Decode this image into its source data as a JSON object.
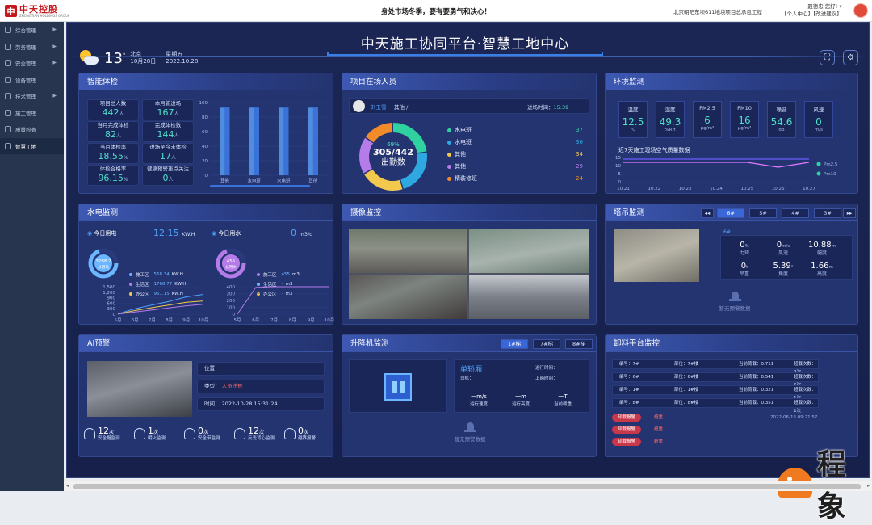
{
  "topbar": {
    "logo_cn": "中天控股",
    "logo_en": "ZHONGTIAN HOLDINGS GROUP",
    "slogan": "身处市场冬季，要有要勇气和决心！",
    "project": "北京朝阳东坝611地块项目总承包工程",
    "user_name": "聂德忠 您好!",
    "user_links": "【个人中心】【改进建议】"
  },
  "sidebar": {
    "items": [
      {
        "label": "综合管理",
        "arrow": true
      },
      {
        "label": "劳务管理",
        "arrow": true
      },
      {
        "label": "安全管理",
        "arrow": true
      },
      {
        "label": "设备管理",
        "arrow": false
      },
      {
        "label": "技术管理",
        "arrow": true
      },
      {
        "label": "施工管理",
        "arrow": false
      },
      {
        "label": "质量检查",
        "arrow": false
      },
      {
        "label": "智慧工地",
        "arrow": false,
        "active": true
      }
    ]
  },
  "header": {
    "title": "中天施工协同平台·智慧工地中心",
    "weather_temp": "13",
    "weather_unit": "°",
    "city": "北京",
    "date_cn": "10月28日",
    "weekday": "星期五",
    "date": "2022.10.28",
    "fullscreen_icon": "fullscreen-icon",
    "settings_icon": "settings-icon"
  },
  "check": {
    "title": "智能体检",
    "stats": [
      {
        "label": "项目总人数",
        "value": "442",
        "unit": "人"
      },
      {
        "label": "本月新进场",
        "value": "167",
        "unit": "人"
      },
      {
        "label": "当月完成体检",
        "value": "82",
        "unit": "人"
      },
      {
        "label": "完成体检数",
        "value": "144",
        "unit": "人"
      },
      {
        "label": "当月体检率",
        "value": "18.55",
        "unit": "%"
      },
      {
        "label": "进场至今未体检",
        "value": "17",
        "unit": "人"
      },
      {
        "label": "体检合格率",
        "value": "96.15",
        "unit": "%"
      },
      {
        "label": "健康预警重点关注",
        "value": "0",
        "unit": "人"
      }
    ],
    "chart_data": {
      "type": "bar",
      "categories": [
        "其他",
        "水电班",
        "水电班",
        "其他"
      ],
      "values": [
        93,
        93,
        93,
        93
      ],
      "ylim": [
        0,
        100
      ],
      "yticks": [
        "100",
        "80",
        "60",
        "40",
        "20",
        "0"
      ]
    }
  },
  "staff": {
    "title": "项目在场人员",
    "person": "刘玉雪",
    "team": "其他",
    "entry_label": "进场时间：",
    "entry_time": "15:39",
    "ring_pct": "69%",
    "ring_total": "305/442",
    "ring_label": "出勤数",
    "chart_data": {
      "type": "pie",
      "categories": [
        "水电班",
        "水电班",
        "其他",
        "其他",
        "精装修班"
      ],
      "values": [
        37,
        36,
        34,
        29,
        24
      ],
      "colors": [
        "#2fd1a0",
        "#2ea8e0",
        "#f2c94c",
        "#b57be8",
        "#f28c2a"
      ]
    }
  },
  "env": {
    "title": "环境监测",
    "cards": [
      {
        "label": "温度",
        "value": "12.5",
        "unit": "℃"
      },
      {
        "label": "湿度",
        "value": "49.3",
        "unit": "%RH"
      },
      {
        "label": "PM2.5",
        "value": "6",
        "unit": "μg/m³"
      },
      {
        "label": "PM10",
        "value": "16",
        "unit": "μg/m³"
      },
      {
        "label": "噪音",
        "value": "54.6",
        "unit": "dB"
      },
      {
        "label": "风速",
        "value": "0",
        "unit": "m/s"
      }
    ],
    "chart_title": "近7天施工现场空气质量数据",
    "chart_data": {
      "type": "line",
      "x": [
        "10.21",
        "10.22",
        "10.23",
        "10.24",
        "10.25",
        "10.26",
        "10.27"
      ],
      "yticks": [
        "15",
        "10",
        "5",
        "0"
      ],
      "series": [
        {
          "name": "Pm2.5",
          "color": "#e47bff",
          "values": [
            12,
            12,
            12,
            12,
            12,
            9,
            12
          ]
        },
        {
          "name": "Pm10",
          "color": "#6b5cff",
          "values": [
            14,
            14,
            14,
            14,
            14,
            14,
            14
          ]
        }
      ],
      "ylim": [
        0,
        15
      ]
    }
  },
  "power": {
    "title": "水电监测",
    "elec_label": "今日用电",
    "elec_value": "12.15",
    "elec_unit": "KW.H",
    "water_label": "今日用水",
    "water_value": "0",
    "water_unit": "m3/d",
    "elec_ring": {
      "value": "3288.2",
      "label": "总用电"
    },
    "water_ring": {
      "value": "455",
      "label": "总用水"
    },
    "elec_items": [
      {
        "label": "施工区",
        "value": "568.34",
        "unit": "KW.H",
        "color": "#6bb6ff"
      },
      {
        "label": "生活区",
        "value": "1768.77",
        "unit": "KW.H",
        "color": "#b57be8"
      },
      {
        "label": "办公区",
        "value": "951.15",
        "unit": "KW.H",
        "color": "#f2c94c"
      }
    ],
    "water_items": [
      {
        "label": "施工区",
        "value": "455",
        "unit": "m3",
        "color": "#b57be8"
      },
      {
        "label": "生活区",
        "value": "-",
        "unit": "m3",
        "color": "#6bb6ff"
      },
      {
        "label": "办公区",
        "value": "-",
        "unit": "m3",
        "color": "#f2c94c"
      }
    ],
    "chart_data": [
      {
        "type": "line",
        "x": [
          "5月",
          "6月",
          "7月",
          "8月",
          "9月",
          "10月"
        ],
        "yticks": [
          "1,500",
          "1,200",
          "900",
          "600",
          "300",
          "0"
        ],
        "ylim": [
          0,
          1500
        ],
        "series": [
          {
            "color": "#4fa3ff",
            "values": [
              20,
              300,
              500,
              700,
              950,
              1080
            ]
          },
          {
            "color": "#f2c94c",
            "values": [
              10,
              200,
              360,
              500,
              650,
              720
            ]
          },
          {
            "color": "#b57be8",
            "values": [
              5,
              120,
              230,
              350,
              460,
              540
            ]
          }
        ]
      },
      {
        "type": "line",
        "x": [
          "5月",
          "6月",
          "7月",
          "8月",
          "9月",
          "10月"
        ],
        "yticks": [
          "400",
          "300",
          "200",
          "100",
          "0"
        ],
        "ylim": [
          0,
          400
        ],
        "series": [
          {
            "color": "#b57be8",
            "values": [
              0,
              390,
              400,
              400,
              400,
              400
            ]
          }
        ]
      }
    ]
  },
  "camera": {
    "title": "摄像监控"
  },
  "tower": {
    "title": "塔吊监测",
    "tabs": [
      "6#",
      "5#",
      "4#",
      "3#"
    ],
    "prev": "◂◂",
    "next": "▸▸",
    "label": "6#",
    "values": [
      {
        "label": "力矩",
        "value": "0",
        "unit": "%"
      },
      {
        "label": "风速",
        "value": "0",
        "unit": "m/s"
      },
      {
        "label": "幅度",
        "value": "10.88",
        "unit": "m"
      },
      {
        "label": "吊重",
        "value": "0",
        "unit": "t"
      },
      {
        "label": "角度",
        "value": "5.39",
        "unit": "°"
      },
      {
        "label": "高度",
        "value": "1.66",
        "unit": "m"
      }
    ],
    "nodata": "暂无预警数据"
  },
  "ai": {
    "title": "AI预警",
    "position_label": "位置：",
    "type_label": "类型：",
    "type_value": "人员违规",
    "time_label": "时间：",
    "time_value": "2022-10-28 15:31:24",
    "counts": [
      {
        "value": "12",
        "unit": "次",
        "label": "安全帽监测"
      },
      {
        "value": "1",
        "unit": "次",
        "label": "明火监测"
      },
      {
        "value": "0",
        "unit": "次",
        "label": "安全带监测"
      },
      {
        "value": "12",
        "unit": "次",
        "label": "反光背心监测"
      },
      {
        "value": "0",
        "unit": "次",
        "label": "越界报警"
      }
    ]
  },
  "lift": {
    "title": "升降机监测",
    "tabs": [
      "1#梯",
      "7#梯",
      "8#梯"
    ],
    "cage": "单轿厢",
    "driver": "司机：",
    "run_time": "运行时间：",
    "lift_time": "上岗时间：",
    "speed": "一m/s",
    "speed_label": "运行速度",
    "height": "一m",
    "height_label": "运行高度",
    "load": "一T",
    "load_label": "当前载重",
    "nodata": "暂无预警数据"
  },
  "unload": {
    "title": "卸料平台监控",
    "rows": [
      {
        "no": "编号：7#",
        "pos": "部位：7#楼",
        "load": "当前荷载：0.711",
        "cnt": "超载次数：2次"
      },
      {
        "no": "编号：6#",
        "pos": "部位：6#楼",
        "load": "当前荷载：0.541",
        "cnt": "超载次数：2次"
      },
      {
        "no": "编号：1#",
        "pos": "部位：1#楼",
        "load": "当前荷载：0.321",
        "cnt": "超载次数：1次"
      },
      {
        "no": "编号：8#",
        "pos": "部位：8#楼",
        "load": "当前荷载：0.351",
        "cnt": "超载次数：1次"
      }
    ],
    "alarms": [
      {
        "badge": "卸载报警",
        "text": "超重",
        "time": "2022-06-16 09:21:57"
      },
      {
        "badge": "卸载报警",
        "text": "超重",
        "time": ""
      },
      {
        "badge": "卸载报警",
        "text": "超重",
        "time": ""
      }
    ]
  },
  "watermark": {
    "text": "程象"
  }
}
